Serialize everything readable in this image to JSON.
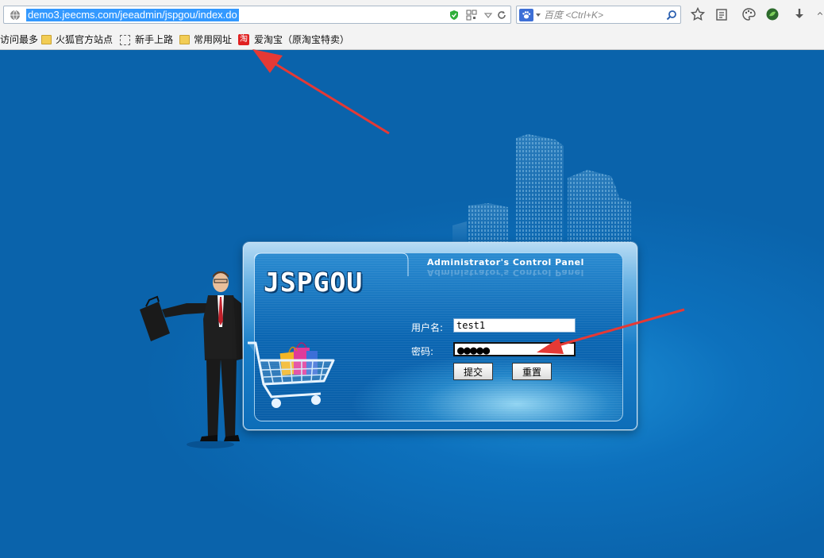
{
  "browser": {
    "url": "demo3.jeecms.com/jeeadmin/jspgou/index.do",
    "search_placeholder": "百度 <Ctrl+K>",
    "bookmarks": [
      {
        "label": "访问最多",
        "icon": "none"
      },
      {
        "label": "火狐官方站点",
        "icon": "folder-icon"
      },
      {
        "label": "新手上路",
        "icon": "dashed-page-icon"
      },
      {
        "label": "常用网址",
        "icon": "folder-icon"
      },
      {
        "label": "爱淘宝（原淘宝特卖）",
        "icon": "taobao-icon",
        "icon_glyph": "淘"
      }
    ]
  },
  "login": {
    "logo": "JSPGOU",
    "panel_title": "Administrator's Control Panel",
    "username_label": "用户名:",
    "username_value": "test1",
    "password_label": "密码:",
    "password_value": "●●●●●",
    "submit_label": "提交",
    "reset_label": "重置"
  },
  "colors": {
    "page_background": "#0a63ab",
    "annotation_arrow": "#e53935",
    "url_highlight": "#3399ff"
  }
}
